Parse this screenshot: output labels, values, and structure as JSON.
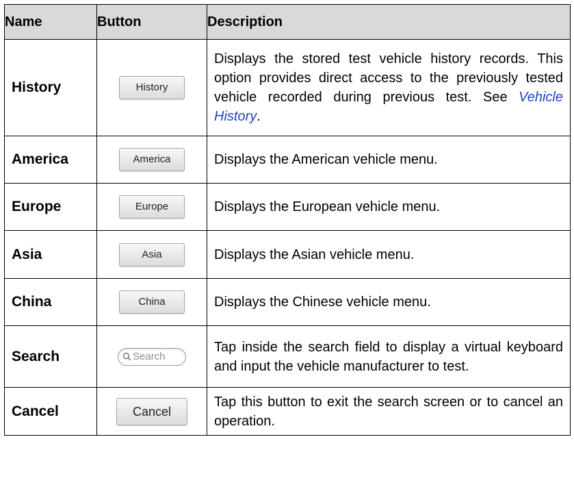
{
  "headers": {
    "name": "Name",
    "button": "Button",
    "description": "Description"
  },
  "rows": [
    {
      "name": "History",
      "button": "History",
      "description_prefix": "Displays the stored test vehicle history records. This option provides direct access to the previously tested vehicle recorded during previous test. See ",
      "link": "Vehicle History",
      "description_suffix": "."
    },
    {
      "name": "America",
      "button": "America",
      "description": "Displays the American vehicle menu."
    },
    {
      "name": "Europe",
      "button": "Europe",
      "description": "Displays the European vehicle menu."
    },
    {
      "name": "Asia",
      "button": "Asia",
      "description": "Displays the Asian vehicle menu."
    },
    {
      "name": "China",
      "button": "China",
      "description": "Displays the Chinese vehicle menu."
    },
    {
      "name": "Search",
      "button": "Search",
      "button_icon": "search-icon",
      "description": "Tap inside the search field to display a virtual keyboard and input the vehicle manufacturer to test."
    },
    {
      "name": "Cancel",
      "button": "Cancel",
      "description": "Tap this button to exit the search screen or to cancel an operation."
    }
  ],
  "colors": {
    "header_bg": "#d9d9d9",
    "link": "#1f3fcf"
  }
}
